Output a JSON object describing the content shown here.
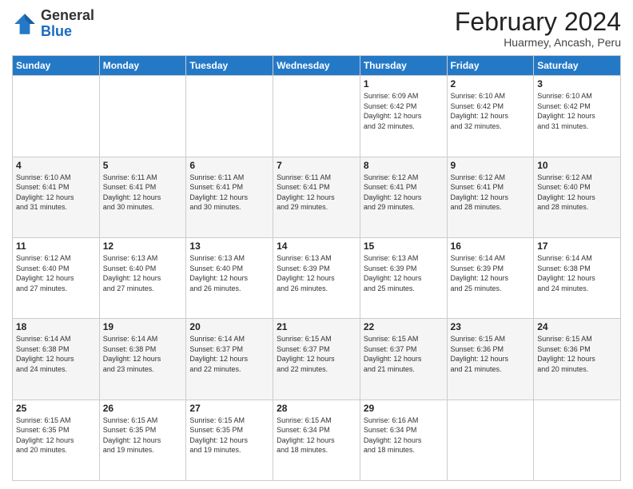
{
  "logo": {
    "general": "General",
    "blue": "Blue"
  },
  "header": {
    "month": "February 2024",
    "location": "Huarmey, Ancash, Peru"
  },
  "weekdays": [
    "Sunday",
    "Monday",
    "Tuesday",
    "Wednesday",
    "Thursday",
    "Friday",
    "Saturday"
  ],
  "weeks": [
    [
      {
        "day": "",
        "info": ""
      },
      {
        "day": "",
        "info": ""
      },
      {
        "day": "",
        "info": ""
      },
      {
        "day": "",
        "info": ""
      },
      {
        "day": "1",
        "info": "Sunrise: 6:09 AM\nSunset: 6:42 PM\nDaylight: 12 hours\nand 32 minutes."
      },
      {
        "day": "2",
        "info": "Sunrise: 6:10 AM\nSunset: 6:42 PM\nDaylight: 12 hours\nand 32 minutes."
      },
      {
        "day": "3",
        "info": "Sunrise: 6:10 AM\nSunset: 6:42 PM\nDaylight: 12 hours\nand 31 minutes."
      }
    ],
    [
      {
        "day": "4",
        "info": "Sunrise: 6:10 AM\nSunset: 6:41 PM\nDaylight: 12 hours\nand 31 minutes."
      },
      {
        "day": "5",
        "info": "Sunrise: 6:11 AM\nSunset: 6:41 PM\nDaylight: 12 hours\nand 30 minutes."
      },
      {
        "day": "6",
        "info": "Sunrise: 6:11 AM\nSunset: 6:41 PM\nDaylight: 12 hours\nand 30 minutes."
      },
      {
        "day": "7",
        "info": "Sunrise: 6:11 AM\nSunset: 6:41 PM\nDaylight: 12 hours\nand 29 minutes."
      },
      {
        "day": "8",
        "info": "Sunrise: 6:12 AM\nSunset: 6:41 PM\nDaylight: 12 hours\nand 29 minutes."
      },
      {
        "day": "9",
        "info": "Sunrise: 6:12 AM\nSunset: 6:41 PM\nDaylight: 12 hours\nand 28 minutes."
      },
      {
        "day": "10",
        "info": "Sunrise: 6:12 AM\nSunset: 6:40 PM\nDaylight: 12 hours\nand 28 minutes."
      }
    ],
    [
      {
        "day": "11",
        "info": "Sunrise: 6:12 AM\nSunset: 6:40 PM\nDaylight: 12 hours\nand 27 minutes."
      },
      {
        "day": "12",
        "info": "Sunrise: 6:13 AM\nSunset: 6:40 PM\nDaylight: 12 hours\nand 27 minutes."
      },
      {
        "day": "13",
        "info": "Sunrise: 6:13 AM\nSunset: 6:40 PM\nDaylight: 12 hours\nand 26 minutes."
      },
      {
        "day": "14",
        "info": "Sunrise: 6:13 AM\nSunset: 6:39 PM\nDaylight: 12 hours\nand 26 minutes."
      },
      {
        "day": "15",
        "info": "Sunrise: 6:13 AM\nSunset: 6:39 PM\nDaylight: 12 hours\nand 25 minutes."
      },
      {
        "day": "16",
        "info": "Sunrise: 6:14 AM\nSunset: 6:39 PM\nDaylight: 12 hours\nand 25 minutes."
      },
      {
        "day": "17",
        "info": "Sunrise: 6:14 AM\nSunset: 6:38 PM\nDaylight: 12 hours\nand 24 minutes."
      }
    ],
    [
      {
        "day": "18",
        "info": "Sunrise: 6:14 AM\nSunset: 6:38 PM\nDaylight: 12 hours\nand 24 minutes."
      },
      {
        "day": "19",
        "info": "Sunrise: 6:14 AM\nSunset: 6:38 PM\nDaylight: 12 hours\nand 23 minutes."
      },
      {
        "day": "20",
        "info": "Sunrise: 6:14 AM\nSunset: 6:37 PM\nDaylight: 12 hours\nand 22 minutes."
      },
      {
        "day": "21",
        "info": "Sunrise: 6:15 AM\nSunset: 6:37 PM\nDaylight: 12 hours\nand 22 minutes."
      },
      {
        "day": "22",
        "info": "Sunrise: 6:15 AM\nSunset: 6:37 PM\nDaylight: 12 hours\nand 21 minutes."
      },
      {
        "day": "23",
        "info": "Sunrise: 6:15 AM\nSunset: 6:36 PM\nDaylight: 12 hours\nand 21 minutes."
      },
      {
        "day": "24",
        "info": "Sunrise: 6:15 AM\nSunset: 6:36 PM\nDaylight: 12 hours\nand 20 minutes."
      }
    ],
    [
      {
        "day": "25",
        "info": "Sunrise: 6:15 AM\nSunset: 6:35 PM\nDaylight: 12 hours\nand 20 minutes."
      },
      {
        "day": "26",
        "info": "Sunrise: 6:15 AM\nSunset: 6:35 PM\nDaylight: 12 hours\nand 19 minutes."
      },
      {
        "day": "27",
        "info": "Sunrise: 6:15 AM\nSunset: 6:35 PM\nDaylight: 12 hours\nand 19 minutes."
      },
      {
        "day": "28",
        "info": "Sunrise: 6:15 AM\nSunset: 6:34 PM\nDaylight: 12 hours\nand 18 minutes."
      },
      {
        "day": "29",
        "info": "Sunrise: 6:16 AM\nSunset: 6:34 PM\nDaylight: 12 hours\nand 18 minutes."
      },
      {
        "day": "",
        "info": ""
      },
      {
        "day": "",
        "info": ""
      }
    ]
  ]
}
